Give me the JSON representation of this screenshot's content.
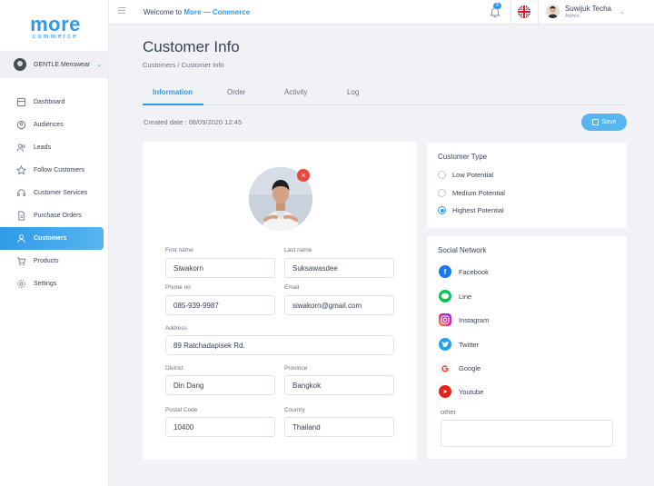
{
  "brand": {
    "logo_main": "more",
    "logo_sub": "commerce"
  },
  "shop": {
    "name": "GENTLE Menswear"
  },
  "sidebar": {
    "items": [
      {
        "label": "Dashboard",
        "icon": "dashboard-icon"
      },
      {
        "label": "Audiences",
        "icon": "audiences-icon"
      },
      {
        "label": "Leads",
        "icon": "leads-icon"
      },
      {
        "label": "Follow Customers",
        "icon": "star-icon"
      },
      {
        "label": "Customer Services",
        "icon": "headset-icon"
      },
      {
        "label": "Purchase Orders",
        "icon": "document-icon"
      },
      {
        "label": "Customers",
        "icon": "user-icon",
        "active": true
      },
      {
        "label": "Products",
        "icon": "cart-icon"
      },
      {
        "label": "Settings",
        "icon": "gear-icon"
      }
    ]
  },
  "topbar": {
    "welcome_prefix": "Welcome to",
    "welcome_brand": "More — Commerce",
    "notification_count": "9",
    "user_name": "Suwijuk Techa",
    "user_role": "Admin"
  },
  "page": {
    "title": "Customer Info",
    "breadcrumb": "Customers / Customer Info",
    "tabs": [
      "Information",
      "Order",
      "Activity",
      "Log"
    ],
    "created": "Created date : 08/09/2020 12:45",
    "save_label": "Save"
  },
  "form": {
    "first_name": {
      "label": "First name",
      "value": "Siwakorn"
    },
    "last_name": {
      "label": "Last name",
      "value": "Suksawasdee"
    },
    "phone": {
      "label": "Phone no",
      "value": "085-939-9987"
    },
    "email": {
      "label": "Email",
      "value": "siwakorn@gmail.com"
    },
    "address": {
      "label": "Address",
      "value": "89 Ratchadapisek Rd."
    },
    "district": {
      "label": "District",
      "value": "Din Dang"
    },
    "province": {
      "label": "Province",
      "value": "Bangkok"
    },
    "postal": {
      "label": "Postal Code",
      "value": "10400"
    },
    "country": {
      "label": "Country",
      "value": "Thailand"
    }
  },
  "customer_type": {
    "title": "Customer Type",
    "options": [
      "Low Potential",
      "Medium Potential",
      "Highest Potential"
    ],
    "selected": "Highest Potential"
  },
  "social": {
    "title": "Social Network",
    "items": [
      {
        "label": "Facebook",
        "color": "#1877f2"
      },
      {
        "label": "Line",
        "color": "#06c755"
      },
      {
        "label": "Instagram",
        "color": "#d6249f"
      },
      {
        "label": "Twitter",
        "color": "#1da1f2"
      },
      {
        "label": "Google",
        "color": "#ea4335"
      },
      {
        "label": "Youtube",
        "color": "#e62117"
      }
    ],
    "other_label": "other"
  },
  "colors": {
    "accent": "#2f9ae8",
    "danger": "#e8493f"
  }
}
